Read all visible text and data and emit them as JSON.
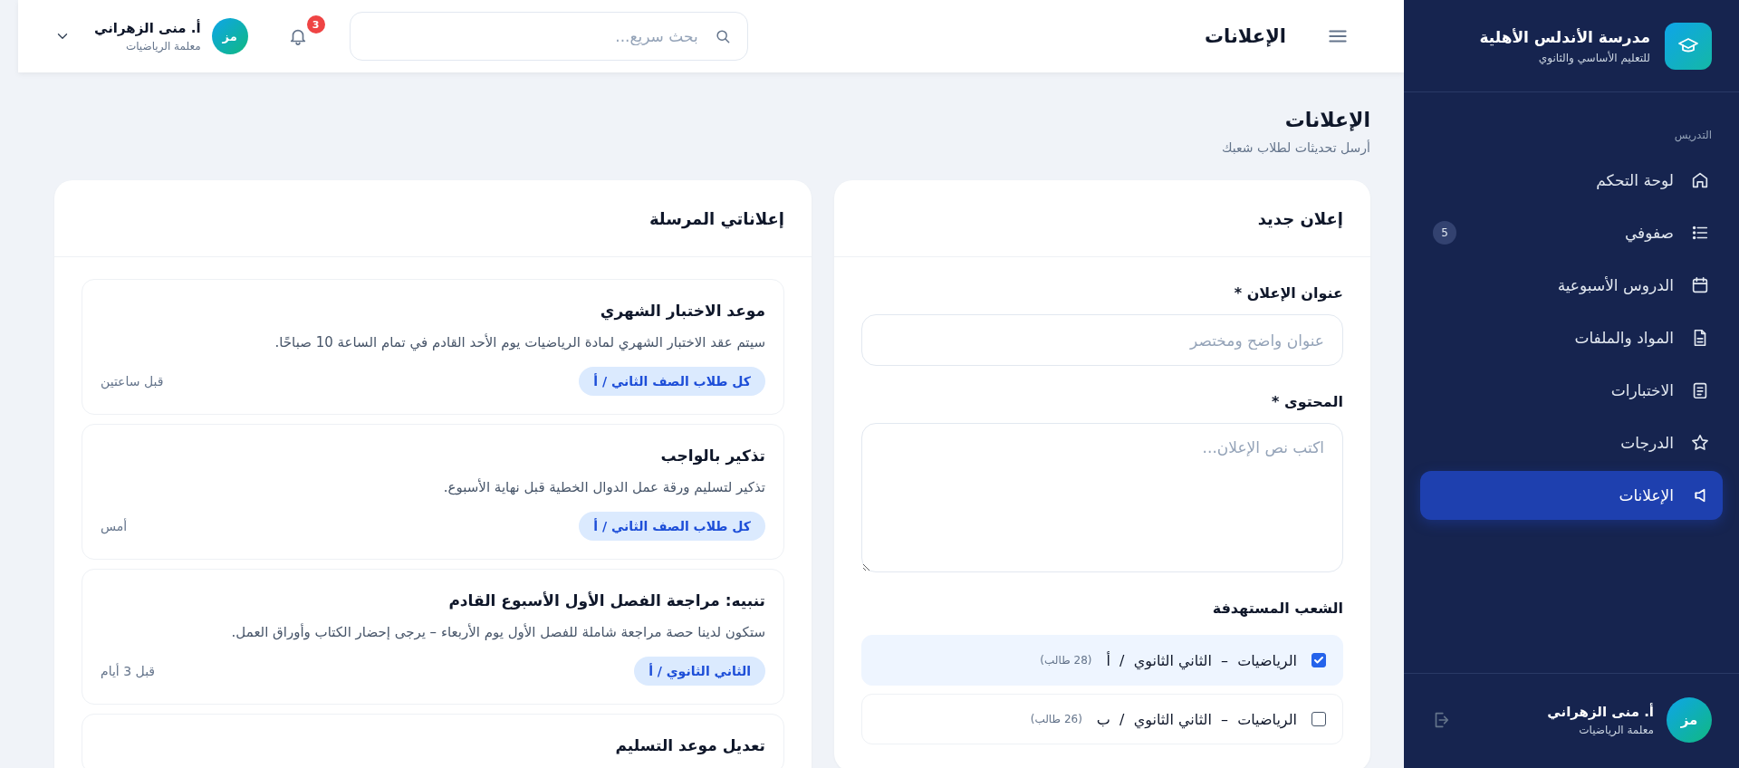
{
  "sidebar": {
    "brand": {
      "name": "مدرسة الأندلس الأهلية",
      "subtitle": "للتعليم الأساسي والثانوي"
    },
    "section_label": "التدريس",
    "items": [
      {
        "kind": "home",
        "label": "لوحة التحكم",
        "selected": false
      },
      {
        "kind": "list",
        "label": "صفوفي",
        "badge": "5",
        "selected": false
      },
      {
        "kind": "calendar",
        "label": "الدروس الأسبوعية",
        "selected": false
      },
      {
        "kind": "file",
        "label": "المواد والملفات",
        "selected": false
      },
      {
        "kind": "doc",
        "label": "الاختبارات",
        "selected": false
      },
      {
        "kind": "star",
        "label": "الدرجات",
        "selected": false
      },
      {
        "kind": "megaphone",
        "label": "الإعلانات",
        "selected": true
      }
    ],
    "user": {
      "initials": "مز",
      "name": "أ. منى الزهراني",
      "role": "معلمة الرياضيات"
    }
  },
  "topbar": {
    "title": "الإعلانات",
    "search": {
      "placeholder": "بحث سريع..."
    },
    "notifications": "3",
    "user": {
      "initials": "مز",
      "name": "أ. منى الزهراني",
      "role": "معلمة الرياضيات"
    }
  },
  "page_header": {
    "title": "الإعلانات",
    "subtitle": "أرسل تحديثات لطلاب شعبك"
  },
  "new_announcement": {
    "title": "إعلان جديد",
    "fields": [
      {
        "kind": "input",
        "label": "عنوان الإعلان *",
        "placeholder": "عنوان واضح ومختصر"
      },
      {
        "kind": "textarea",
        "label": "المحتوى *",
        "placeholder": "اكتب نص الإعلان..."
      }
    ],
    "sections_label": "الشعب المستهدفة",
    "sections": [
      {
        "label": "الرياضيات  –  الثاني الثانوي  /  أ",
        "count": "(28 طالب)",
        "checked": true
      },
      {
        "label": "الرياضيات  –  الثاني الثانوي  /  ب",
        "count": "(26 طالب)",
        "checked": false
      }
    ]
  },
  "sent_announcements": {
    "title": "إعلاناتي المرسلة",
    "items": [
      {
        "title": "موعد الاختبار الشهري",
        "body": "سيتم عقد الاختبار الشهري لمادة الرياضيات يوم الأحد القادم في تمام الساعة 10 صباحًا.",
        "audience": "كل طلاب الصف الثاني / أ",
        "time": "قبل ساعتين"
      },
      {
        "title": "تذكير بالواجب",
        "body": "تذكير لتسليم ورقة عمل الدوال الخطية قبل نهاية الأسبوع.",
        "audience": "كل طلاب الصف الثاني / أ",
        "time": "أمس"
      },
      {
        "title": "تنبيه: مراجعة الفصل الأول الأسبوع القادم",
        "body": "ستكون لدينا حصة مراجعة شاملة للفصل الأول يوم الأربعاء – يرجى إحضار الكتاب وأوراق العمل.",
        "audience": "الثاني الثانوي / أ",
        "time": "قبل 3 أيام"
      },
      {
        "title": "تعديل موعد التسليم"
      }
    ]
  }
}
